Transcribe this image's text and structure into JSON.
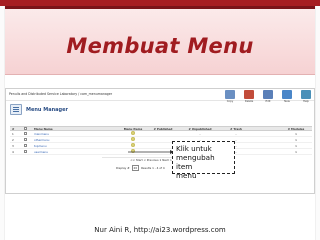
{
  "slide": {
    "title": "Membuat Menu",
    "footer": "Nur Aini R, http://ai23.wordpress.com",
    "accent": "#a61e22",
    "title_color": "#a01c20"
  },
  "admin": {
    "site_title": "Penulis and Distributed Service Laboratory / com_menumanager",
    "toolbar": [
      {
        "label": "Copy",
        "icon": "copy-icon",
        "color": "#6a8fc2"
      },
      {
        "label": "Delete",
        "icon": "delete-icon",
        "color": "#c24c3a"
      },
      {
        "label": "Edit",
        "icon": "edit-icon",
        "color": "#5a7fb8"
      },
      {
        "label": "New",
        "icon": "new-icon",
        "color": "#4a86c8"
      },
      {
        "label": "Help",
        "icon": "help-icon",
        "color": "#4a90b8"
      }
    ],
    "page_title": "Menu Manager",
    "columns": [
      "#",
      "",
      "Menu Name",
      "Menu Items",
      "# Published",
      "# Unpublished",
      "# Trash",
      "# Modules",
      ""
    ],
    "rows": [
      {
        "num": "1",
        "name": "mainmenu",
        "unpublished": "-",
        "trash": "-",
        "modules": "1"
      },
      {
        "num": "2",
        "name": "othermenu",
        "unpublished": "-",
        "trash": "-",
        "modules": "1"
      },
      {
        "num": "3",
        "name": "topmenu",
        "unpublished": "-",
        "trash": "-",
        "modules": "1"
      },
      {
        "num": "4",
        "name": "usermenu",
        "unpublished": "-",
        "trash": "-",
        "modules": "1"
      }
    ],
    "pager": "<< Start < Previous 1 Next > End >>",
    "display_label": "Display #",
    "display_value": "20",
    "results": "Results 1 - 4 of 4"
  },
  "callout": {
    "line1": "Klik untuk",
    "line2": "mengubah item",
    "line3": "menu"
  }
}
